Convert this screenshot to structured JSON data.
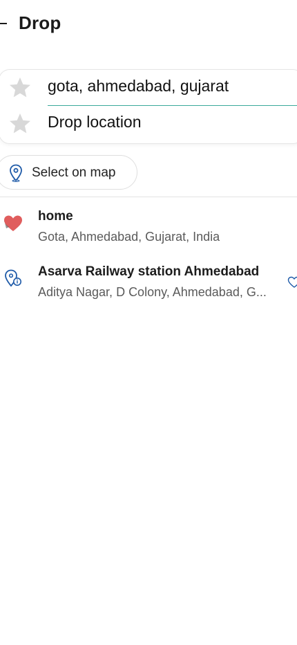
{
  "header": {
    "title": "Drop"
  },
  "locations": {
    "pickup_value": "gota, ahmedabad, gujarat",
    "drop_placeholder": "Drop location"
  },
  "map_button": {
    "label": "Select on map"
  },
  "results": [
    {
      "title": "home",
      "subtitle": "Gota, Ahmedabad, Gujarat, India",
      "icon": "heart-icon"
    },
    {
      "title": "Asarva Railway station Ahmedabad",
      "subtitle": "Aditya Nagar, D Colony, Ahmedabad, G...",
      "icon": "place-info-icon"
    }
  ],
  "colors": {
    "accent": "#3aa99a",
    "heart": "#e05d5d",
    "pin": "#1e5aa8",
    "star": "#d8d8d8"
  }
}
